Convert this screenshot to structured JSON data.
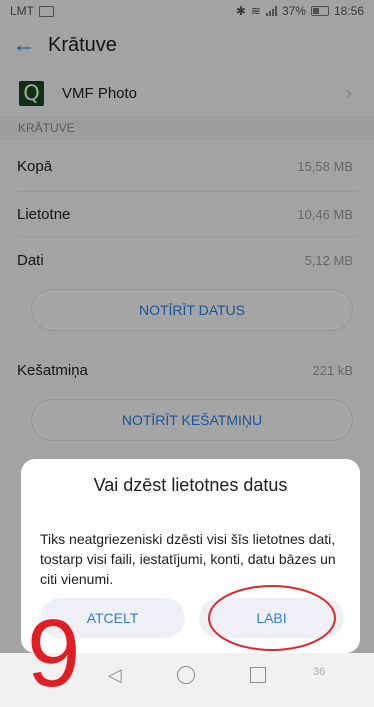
{
  "status_bar": {
    "carrier": "LMT",
    "battery_percent": "37%",
    "time": "18:56",
    "icons": [
      "sim-icon",
      "bluetooth-icon",
      "wifi-icon",
      "signal-icon",
      "battery-icon"
    ]
  },
  "app_bar": {
    "title": "Krātuve",
    "back_icon": "back-arrow-icon"
  },
  "app": {
    "name": "VMF Photo",
    "logo_glyph": "Q",
    "logo_color": "#16461f"
  },
  "storage": {
    "section_header": "KRĀTUVE",
    "rows": [
      {
        "label": "Kopā",
        "value": "15,58 MB"
      },
      {
        "label": "Lietotne",
        "value": "10,46 MB"
      },
      {
        "label": "Dati",
        "value": "5,12 MB"
      }
    ],
    "clear_data_label": "NOTĪRĪT DATUS",
    "cache": {
      "label": "Kešatmiņa",
      "value": "221 kB"
    },
    "clear_cache_label": "NOTĪRĪT KEŠATMIŅU"
  },
  "dialog": {
    "title": "Vai dzēst lietotnes datus",
    "body": "Tiks neatgriezeniski dzēsti visi šīs lietotnes dati, tostarp visi faili, iestatījumi, konti, datu bāzes un citi vienumi.",
    "cancel_label": "ATCELT",
    "ok_label": "LABI"
  },
  "annotation": {
    "step_number": "9",
    "page_number": "36",
    "highlight_color": "#e1262b"
  },
  "colors": {
    "accent": "#2f7de1",
    "background": "#f1f1f1"
  }
}
